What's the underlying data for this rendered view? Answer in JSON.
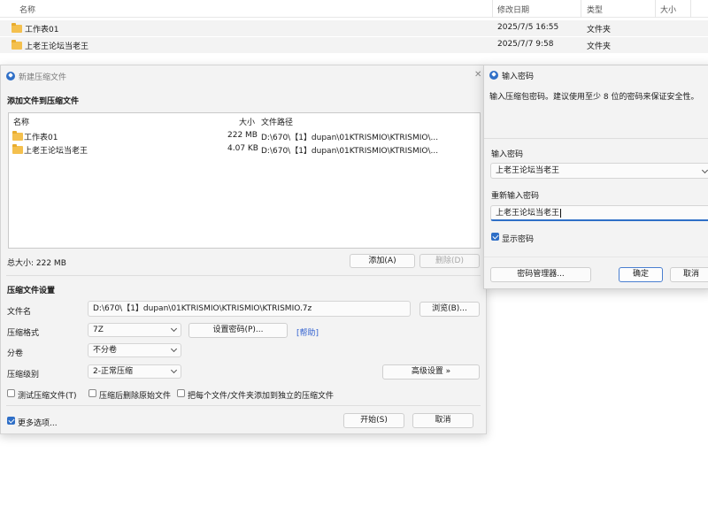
{
  "explorer": {
    "headers": {
      "name": "名称",
      "modified": "修改日期",
      "type": "类型",
      "size": "大小"
    },
    "rows": [
      {
        "name": "工作表01",
        "modified": "2025/7/5 16:55",
        "type": "文件夹"
      },
      {
        "name": "上老王论坛当老王",
        "modified": "2025/7/7 9:58",
        "type": "文件夹"
      }
    ]
  },
  "main_dialog": {
    "title": "新建压缩文件",
    "close_glyph": "✕",
    "add_section_label": "添加文件到压缩文件",
    "list_headers": {
      "name": "名称",
      "size": "大小",
      "path": "文件路径"
    },
    "files": [
      {
        "name": "工作表01",
        "size": "222 MB",
        "path": "D:\\670\\【1】dupan\\01KTRISMIO\\KTRISMIO\\..."
      },
      {
        "name": "上老王论坛当老王",
        "size": "4.07 KB",
        "path": "D:\\670\\【1】dupan\\01KTRISMIO\\KTRISMIO\\..."
      }
    ],
    "total_size": "总大小: 222 MB",
    "add_button": "添加(A)",
    "delete_button": "删除(D)",
    "settings_label": "压缩文件设置",
    "filename_label": "文件名",
    "filename_value": "D:\\670\\【1】dupan\\01KTRISMIO\\KTRISMIO\\KTRISMIO.7z",
    "browse_button": "浏览(B)...",
    "format_label": "压缩格式",
    "format_value": "7Z",
    "set_password_button": "设置密码(P)...",
    "help_link": "[帮助]",
    "volume_label": "分卷",
    "volume_value": "不分卷",
    "level_label": "压缩级别",
    "level_value": "2-正常压缩",
    "advanced_button": "高级设置 »",
    "test_archive": "测试压缩文件(T)",
    "delete_after": "压缩后删除原始文件",
    "separate_archives": "把每个文件/文件夹添加到独立的压缩文件",
    "more_options": "更多选项...",
    "start_button": "开始(S)",
    "cancel_button": "取消"
  },
  "password_dialog": {
    "title": "输入密码",
    "hint": "输入压缩包密码。建议使用至少 8 位的密码来保证安全性。",
    "password_label": "输入密码",
    "password_value": "上老王论坛当老王",
    "confirm_label": "重新输入密码",
    "confirm_value": "上老王论坛当老王",
    "show_password": "显示密码",
    "manager_button": "密码管理器...",
    "ok_button": "确定",
    "cancel_button": "取消"
  },
  "colors": {
    "accent": "#2f6fc7",
    "folder": "#f4c04e",
    "link": "#2f5fcf"
  }
}
